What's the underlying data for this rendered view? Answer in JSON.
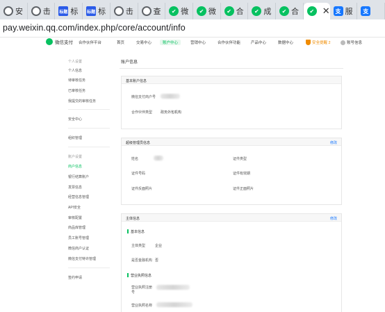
{
  "browser": {
    "tabs": [
      {
        "label": "安",
        "icon": "globe-icon"
      },
      {
        "label": "击",
        "icon": "globe-icon"
      },
      {
        "label": "标",
        "icon": "doc-icon",
        "badge": "标题"
      },
      {
        "label": "标",
        "icon": "doc-icon",
        "badge": "标题"
      },
      {
        "label": "击",
        "icon": "globe-icon"
      },
      {
        "label": "查",
        "icon": "globe-icon"
      },
      {
        "label": "微",
        "icon": "wechat-icon"
      },
      {
        "label": "微",
        "icon": "wechat-icon"
      },
      {
        "label": "合",
        "icon": "wechat-icon"
      },
      {
        "label": "成",
        "icon": "wechat-icon"
      },
      {
        "label": "合",
        "icon": "wechat-icon"
      },
      {
        "label": "",
        "icon": "wechat-icon",
        "active": true
      },
      {
        "label": "服",
        "icon": "blue-icon",
        "badge": "支"
      },
      {
        "label": "",
        "icon": "blue-icon",
        "badge": "支"
      }
    ],
    "close_glyph": "✕",
    "url": "pay.weixin.qq.com/index.php/core/account/info"
  },
  "topnav": {
    "brand": "微信支付",
    "partner": "合作伙伴平台",
    "items": [
      "首页",
      "交易中心",
      "账户中心",
      "营销中心",
      "合作伙伴功能",
      "产品中心",
      "数据中心"
    ],
    "active_index": 2,
    "warning": "安全提醒 2",
    "account": "账号信息"
  },
  "sidebar": {
    "personal_head": "个人设置",
    "personal_items": [
      "个人信息",
      "待审核任务",
      "已审核任务",
      "我提交的审核任务"
    ],
    "security": "安全中心",
    "org": "组织管理",
    "account_head": "账户设置",
    "account_items": [
      "商户信息",
      "银行结算账户",
      "发票信息",
      "经营信息管理",
      "API安全",
      "审核配置",
      "商品库管理",
      "员工账号管理",
      "微信商户认证",
      "微信支付特许管理"
    ],
    "active_item": "商户信息",
    "extra": "签约申请"
  },
  "main": {
    "title": "账户信息",
    "basic": {
      "title": "基本账户信息",
      "rows": [
        {
          "label": "微信支付商户号",
          "value": ""
        },
        {
          "label": "合作伙伴类型",
          "value": "政务外包机构"
        }
      ]
    },
    "admin": {
      "title": "超级管理员信息",
      "edit": "修改",
      "left": [
        "姓名",
        "证件号码",
        "证件反面照片"
      ],
      "right": [
        "证件类型",
        "证件有效期",
        "证件正面照片"
      ]
    },
    "subject": {
      "title": "主体信息",
      "edit": "修改",
      "basic_head": "基本信息",
      "rows": [
        {
          "label": "主体类型",
          "value": "企业"
        },
        {
          "label": "是否金融机构",
          "value": "否"
        }
      ],
      "license_head": "营业执照信息",
      "license_rows": [
        {
          "label": "营业执照注册号"
        },
        {
          "label": "营业执照名称"
        }
      ]
    }
  }
}
